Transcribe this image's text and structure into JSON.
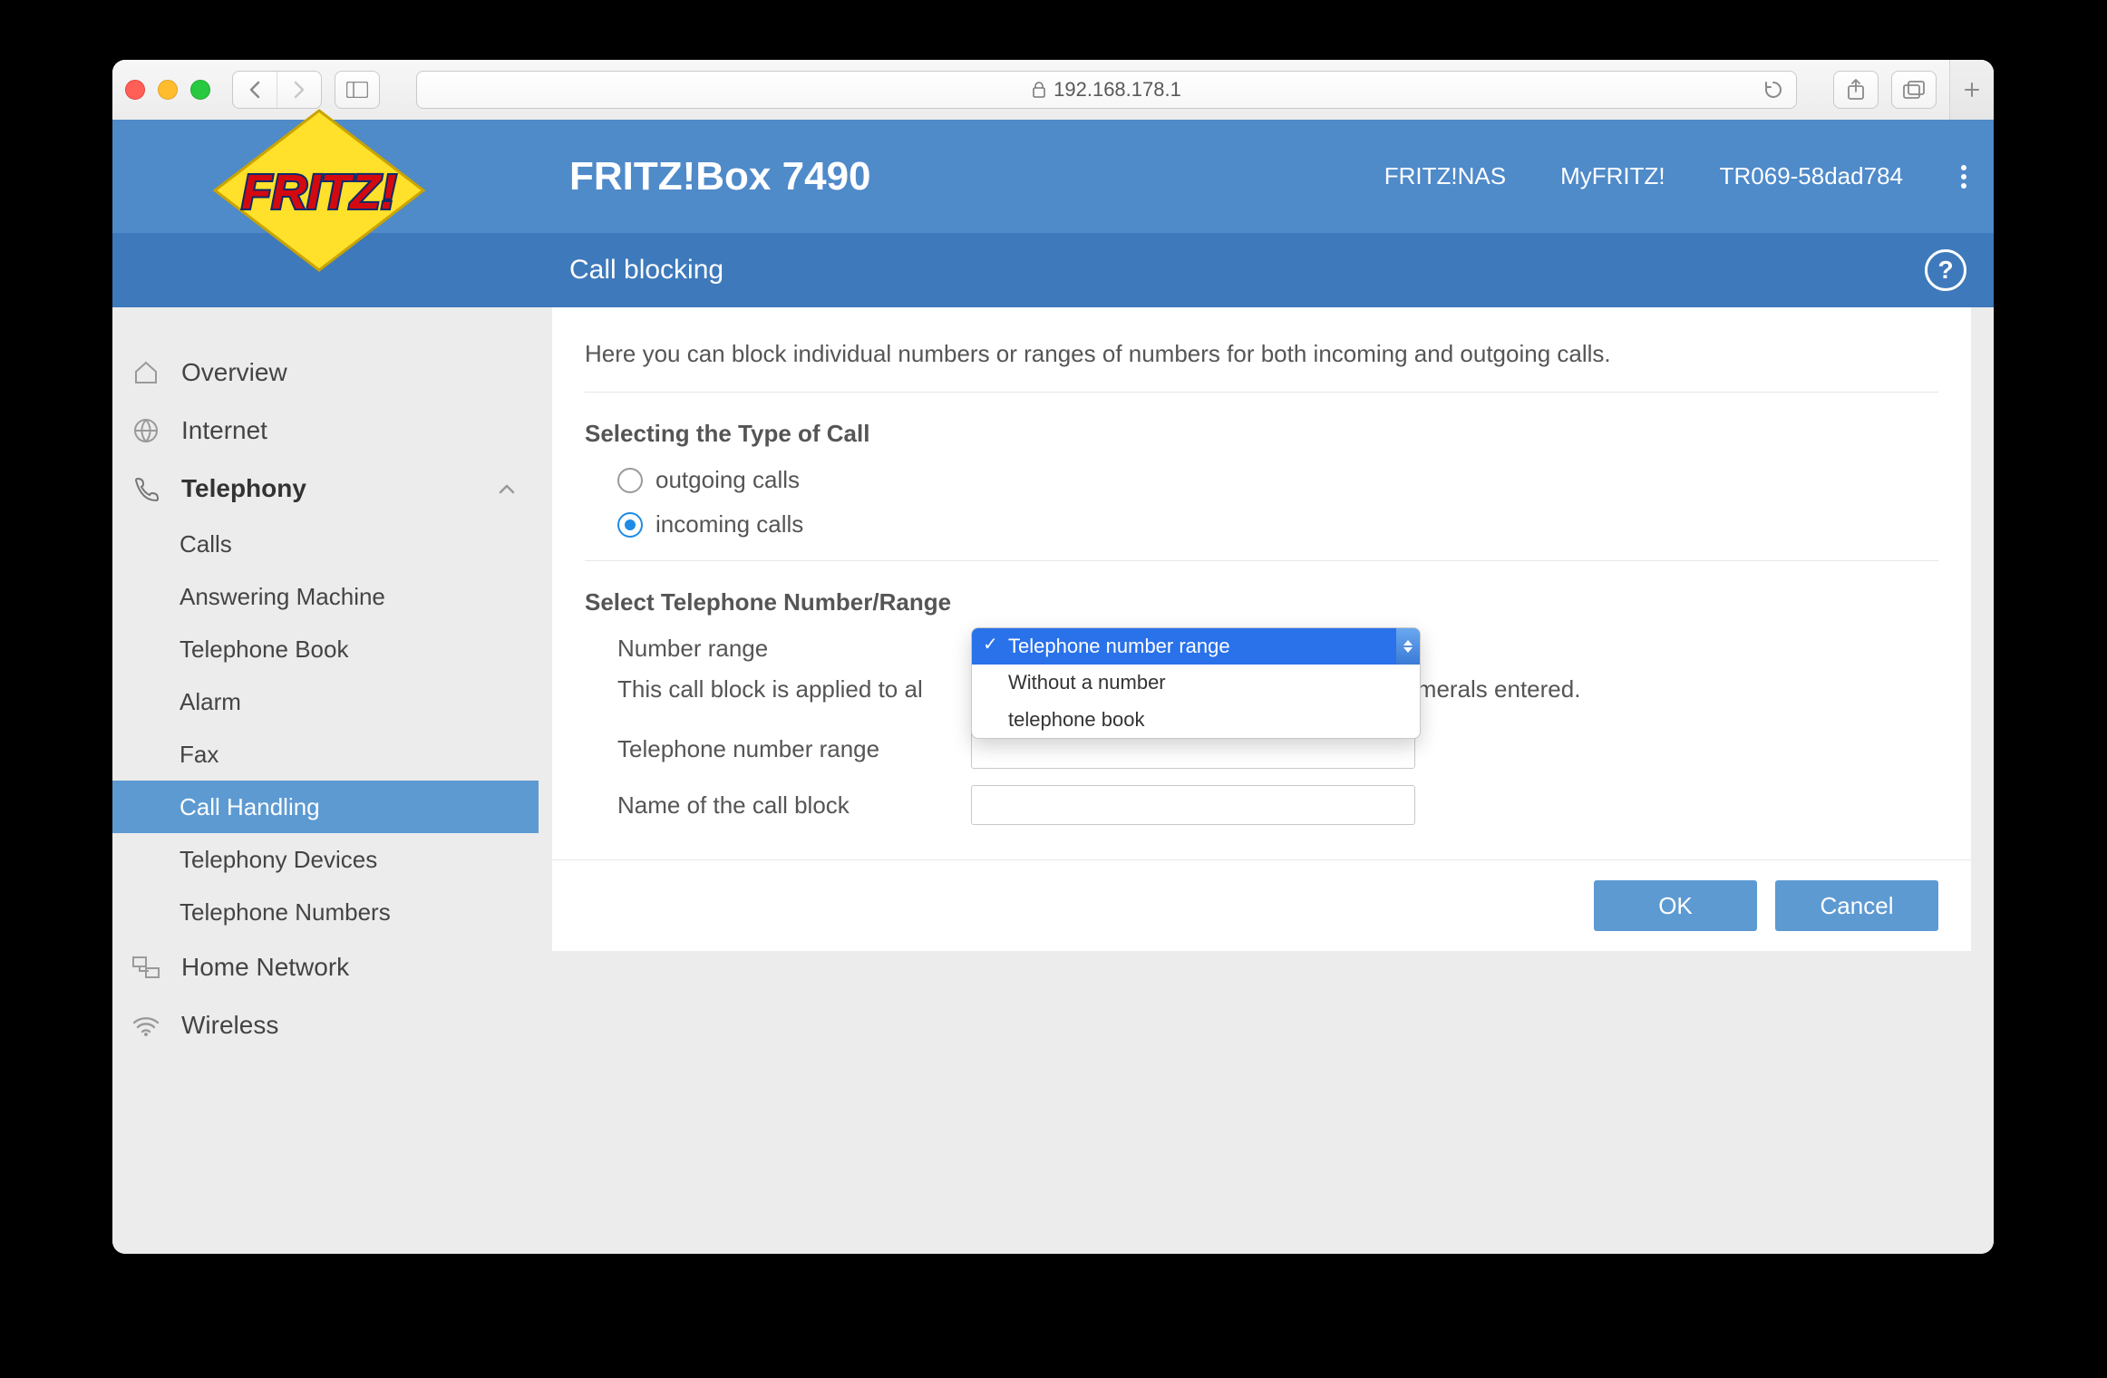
{
  "browser": {
    "address": "192.168.178.1"
  },
  "header": {
    "title": "FRITZ!Box 7490",
    "links": {
      "nas": "FRITZ!NAS",
      "myfritz": "MyFRITZ!",
      "session": "TR069-58dad784"
    }
  },
  "subheader": {
    "title": "Call blocking"
  },
  "sidebar": {
    "overview": "Overview",
    "internet": "Internet",
    "telephony": "Telephony",
    "telephony_children": {
      "calls": "Calls",
      "answering": "Answering Machine",
      "phonebook": "Telephone Book",
      "alarm": "Alarm",
      "fax": "Fax",
      "callhandling": "Call Handling",
      "teldevices": "Telephony Devices",
      "telnumbers": "Telephone Numbers"
    },
    "homenet": "Home Network",
    "wireless": "Wireless"
  },
  "content": {
    "intro": "Here you can block individual numbers or ranges of numbers for both incoming and outgoing calls.",
    "section1_title": "Selecting the Type of Call",
    "radios": {
      "outgoing": "outgoing calls",
      "incoming": "incoming calls"
    },
    "section2_title": "Select Telephone Number/Range",
    "labels": {
      "number_range": "Number range",
      "tel_range": "Telephone number range",
      "block_name": "Name of the call block"
    },
    "note_prefix": "This call block is applied to al",
    "note_suffix": "e numerals entered.",
    "dropdown": {
      "opt_selected": "Telephone number range",
      "opt2": "Without a number",
      "opt3": "telephone book"
    },
    "buttons": {
      "ok": "OK",
      "cancel": "Cancel"
    }
  }
}
